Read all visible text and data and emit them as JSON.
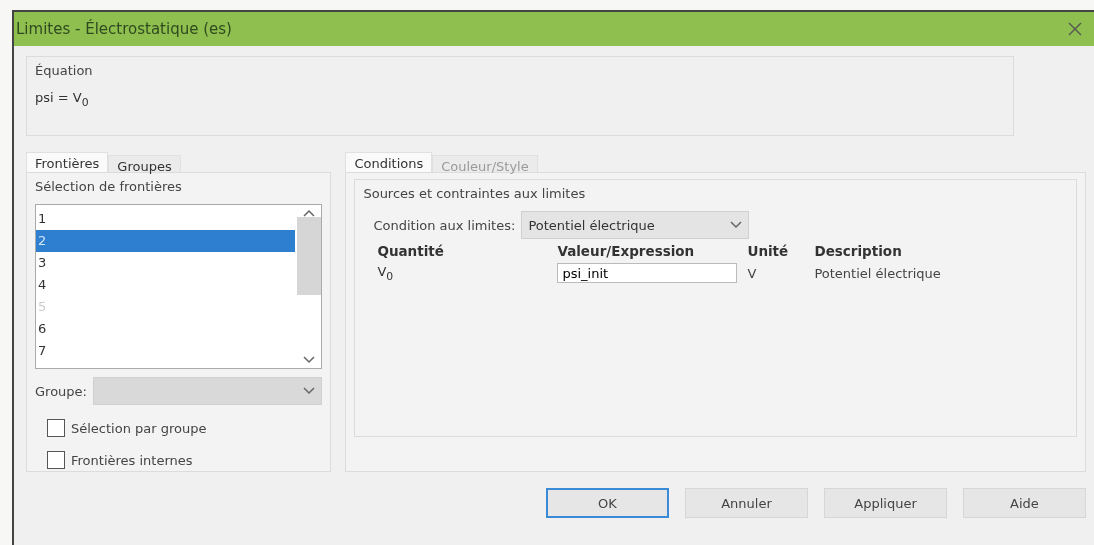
{
  "window": {
    "title": "Limites - Électrostatique (es)"
  },
  "equation": {
    "title": "Équation",
    "formula": "psi = V$_{0}$"
  },
  "left_tabs": [
    {
      "label": "Frontières",
      "selected": true
    },
    {
      "label": "Groupes",
      "selected": false
    }
  ],
  "boundary_selection": {
    "title": "Sélection de frontières",
    "items": [
      {
        "label": "1",
        "selected": false,
        "disabled": false
      },
      {
        "label": "2",
        "selected": true,
        "disabled": false
      },
      {
        "label": "3",
        "selected": false,
        "disabled": false
      },
      {
        "label": "4",
        "selected": false,
        "disabled": false
      },
      {
        "label": "5",
        "selected": false,
        "disabled": true
      },
      {
        "label": "6",
        "selected": false,
        "disabled": false
      },
      {
        "label": "7",
        "selected": false,
        "disabled": false
      }
    ],
    "group_label": "Groupe:",
    "checkboxes": [
      {
        "label": "Sélection par groupe",
        "checked": false
      },
      {
        "label": "Frontières internes",
        "checked": false
      }
    ]
  },
  "right_tabs": [
    {
      "label": "Conditions",
      "selected": true,
      "disabled": false
    },
    {
      "label": "Couleur/Style",
      "selected": false,
      "disabled": true
    }
  ],
  "sources": {
    "title": "Sources et contraintes aux limites",
    "condition_label": "Condition aux limites:",
    "condition_value": "Potentiel électrique",
    "columns": [
      "Quantité",
      "Valeur/Expression",
      "Unité",
      "Description"
    ],
    "rows": [
      {
        "quantity": "V$_{0}$",
        "value": "psi_init",
        "unit": "V",
        "description": "Potentiel électrique"
      }
    ]
  },
  "buttons": [
    {
      "label": "OK",
      "default": true
    },
    {
      "label": "Annuler",
      "default": false
    },
    {
      "label": "Appliquer",
      "default": false
    },
    {
      "label": "Aide",
      "default": false
    }
  ]
}
